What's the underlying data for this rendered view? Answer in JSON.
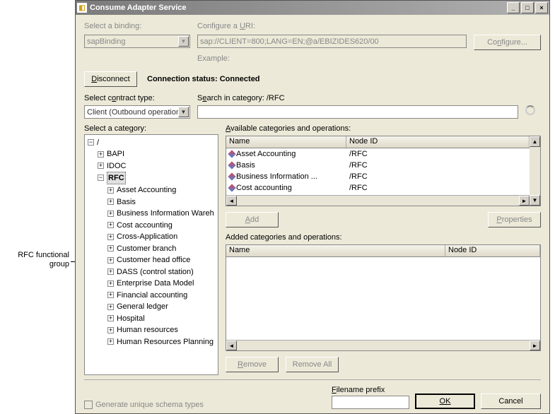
{
  "annotation": "RFC functional group",
  "window": {
    "title": "Consume Adapter Service",
    "min": "_",
    "max": "□",
    "close": "×"
  },
  "binding": {
    "label": "Select a binding:",
    "value": "sapBinding"
  },
  "uri": {
    "label_pre": "Configure a ",
    "label_key": "U",
    "label_post": "RI:",
    "value": "sap://CLIENT=800;LANG=EN;@a/EBIZIDES620/00",
    "example_label": "Example:"
  },
  "configure_btn_pre": "Co",
  "configure_btn_key": "n",
  "configure_btn_post": "figure...",
  "disconnect_btn_key": "D",
  "disconnect_btn_post": "isconnect",
  "conn_status_label": "Connection status:",
  "conn_status_value": "Connected",
  "contract": {
    "label_pre": "Select c",
    "label_key": "o",
    "label_post": "ntract type:",
    "value": "Client (Outbound operations)"
  },
  "search": {
    "label_pre": "S",
    "label_key": "e",
    "label_post": "arch in category:",
    "category": "/RFC",
    "value": ""
  },
  "category_label_pre": "Select a cate",
  "category_label_key": "g",
  "category_label_post": "ory:",
  "tree": {
    "root": "/",
    "l1": [
      {
        "label": "BAPI",
        "exp": "+"
      },
      {
        "label": "IDOC",
        "exp": "+"
      },
      {
        "label": "RFC",
        "exp": "−",
        "selected": true
      }
    ],
    "rfc_children": [
      "Asset Accounting",
      "Basis",
      "Business Information Wareh",
      "Cost accounting",
      "Cross-Application",
      "Customer branch",
      "Customer head office",
      "DASS (control station)",
      "Enterprise Data Model",
      "Financial accounting",
      "General ledger",
      "Hospital",
      "Human resources",
      "Human Resources Planning"
    ]
  },
  "available": {
    "label_key": "A",
    "label_post": "vailable categories and operations:",
    "cols": {
      "name": "Name",
      "nodeid": "Node ID"
    },
    "rows": [
      {
        "name": "Asset Accounting",
        "nodeid": "/RFC"
      },
      {
        "name": "Basis",
        "nodeid": "/RFC"
      },
      {
        "name": "Business Information ...",
        "nodeid": "/RFC"
      },
      {
        "name": "Cost accounting",
        "nodeid": "/RFC"
      }
    ]
  },
  "add_btn_key": "A",
  "add_btn_post": "dd",
  "properties_btn_key": "P",
  "properties_btn_post": "roperties",
  "added": {
    "label": "Added categories and operations:",
    "cols": {
      "name": "Name",
      "nodeid": "Node ID"
    }
  },
  "remove_btn_key": "R",
  "remove_btn_post": "emove",
  "removeall_btn": "Remove All",
  "generate_checkbox": "Generate unique schema types",
  "filename_prefix_pre": "",
  "filename_prefix_key": "F",
  "filename_prefix_post": "ilename prefix",
  "ok_btn": "OK",
  "cancel_btn": "Cancel"
}
